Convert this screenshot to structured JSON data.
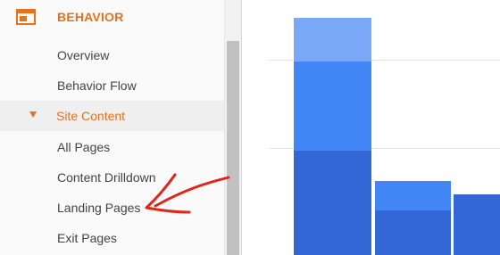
{
  "sidebar": {
    "section_title": "BEHAVIOR",
    "section_icon": "behavior-icon",
    "items": [
      {
        "label": "Overview"
      },
      {
        "label": "Behavior Flow"
      },
      {
        "label": "Site Content"
      },
      {
        "label": "All Pages"
      },
      {
        "label": "Content Drilldown"
      },
      {
        "label": "Landing Pages"
      },
      {
        "label": "Exit Pages"
      }
    ],
    "active_item": "Site Content",
    "annotation": "red-arrow-pointing-to-landing-pages"
  },
  "colors": {
    "accent": "#e8711c",
    "bar_light": "#7aa7f7",
    "bar_mid": "#4285f4",
    "bar_dark": "#3367d6",
    "arrow": "#e0251b"
  },
  "chart_data": {
    "type": "bar",
    "stacked": true,
    "title": "",
    "xlabel": "",
    "ylabel": "",
    "categories": [
      "",
      "",
      ""
    ],
    "series": [
      {
        "values": [
          117,
          50,
          68
        ]
      },
      {
        "values": [
          100,
          33,
          0
        ]
      },
      {
        "values": [
          49,
          0,
          0
        ]
      }
    ],
    "grid": true
  }
}
